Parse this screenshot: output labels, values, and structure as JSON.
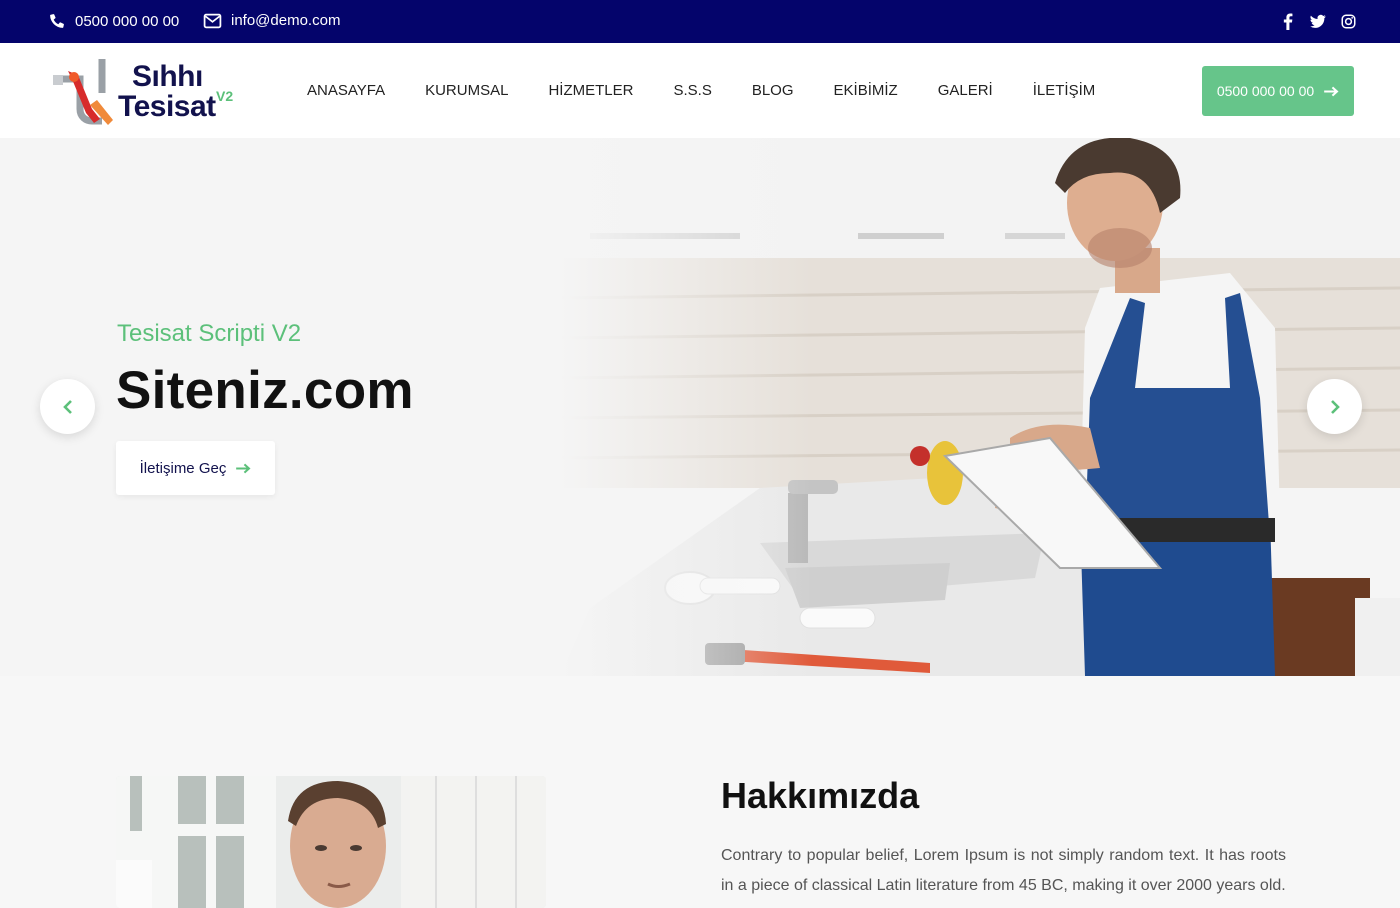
{
  "topbar": {
    "phone": "0500 000 00 00",
    "email": "info@demo.com",
    "phone_icon": "phone-icon",
    "email_icon": "envelope-icon",
    "social": [
      "facebook-icon",
      "twitter-icon",
      "instagram-icon"
    ],
    "background": "#04046b"
  },
  "header": {
    "logo_line1": "Sıhhı",
    "logo_line2": "Tesisat",
    "logo_version": "V2",
    "nav": [
      "ANASAYFA",
      "KURUMSAL",
      "HİZMETLER",
      "S.S.S",
      "BLOG",
      "EKİBİMİZ",
      "GALERİ",
      "İLETİŞİM"
    ],
    "cta_label": "0500 000 00 00",
    "accent": "#66c58a"
  },
  "hero": {
    "subtitle": "Tesisat Scripti V2",
    "title": "Siteniz.com",
    "button_label": "İletişime Geç"
  },
  "about": {
    "title": "Hakkımızda",
    "text": "Contrary to popular belief, Lorem Ipsum is not simply random text. It has roots in a piece of classical Latin literature from 45 BC, making it over 2000 years old."
  }
}
